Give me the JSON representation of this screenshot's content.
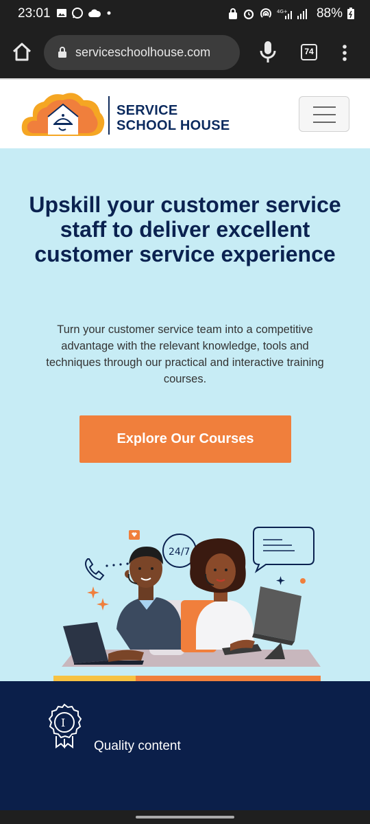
{
  "status_bar": {
    "time": "23:01",
    "battery": "88%",
    "network": "4G+"
  },
  "browser": {
    "url": "serviceschoolhouse.com",
    "tab_count": "74"
  },
  "header": {
    "brand_line1": "SERVICE",
    "brand_line2": "SCHOOL HOUSE"
  },
  "hero": {
    "title": "Upskill your customer service staff to deliver excellent customer service experience",
    "subtitle": "Turn your customer service team into a competitive advantage with the relevant knowledge, tools and techniques through our practical and interactive training courses.",
    "cta_label": "Explore Our Courses",
    "illustration_badge": "24/7"
  },
  "features": {
    "item1_label": "Quality content"
  },
  "colors": {
    "accent": "#f07f3c",
    "navy": "#0b1f4a",
    "hero_bg": "#c7ecf5"
  }
}
